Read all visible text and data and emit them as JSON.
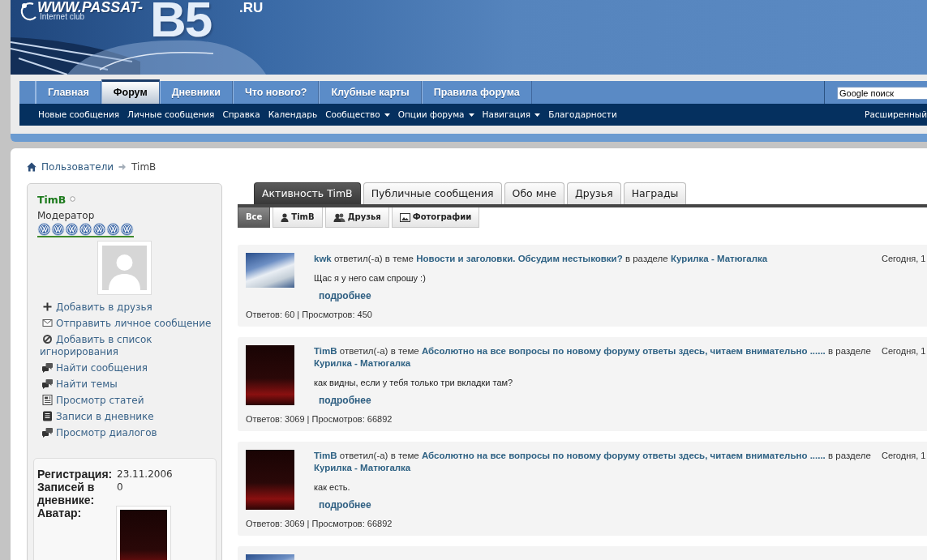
{
  "logo": {
    "site": "WWW.PASSAT-",
    "mark": "B5",
    "domain": ".RU",
    "tagline": "Internet club"
  },
  "nav": {
    "tabs": [
      {
        "label": "Главная",
        "selected": false
      },
      {
        "label": "Форум",
        "selected": true
      },
      {
        "label": "Дневники",
        "selected": false
      },
      {
        "label": "Что нового?",
        "selected": false
      },
      {
        "label": "Клубные карты",
        "selected": false
      },
      {
        "label": "Правила форума",
        "selected": false
      }
    ],
    "search": {
      "value": "Google поиск"
    }
  },
  "subnav": {
    "links": [
      {
        "label": "Новые сообщения",
        "menu": false
      },
      {
        "label": "Личные сообщения",
        "menu": false
      },
      {
        "label": "Справка",
        "menu": false
      },
      {
        "label": "Календарь",
        "menu": false
      },
      {
        "label": "Сообщество",
        "menu": true
      },
      {
        "label": "Опции форума",
        "menu": true
      },
      {
        "label": "Навигация",
        "menu": true
      },
      {
        "label": "Благодарности",
        "menu": false
      }
    ],
    "right_link": "Расширенный"
  },
  "breadcrumb": {
    "links": [
      "Пользователи"
    ],
    "current": "TimB"
  },
  "profile": {
    "name": "TimB",
    "online": false,
    "title": "Модератор",
    "rank": [
      {
        "kind": "emblem"
      },
      {
        "kind": "emblem"
      },
      {
        "kind": "emblem"
      },
      {
        "kind": "emblem"
      },
      {
        "kind": "emblem"
      },
      {
        "kind": "emblem"
      },
      {
        "kind": "emblem"
      }
    ],
    "actions": [
      {
        "kind": "plus",
        "label": "Добавить в друзья"
      },
      {
        "kind": "mail",
        "label": "Отправить личное сообщение"
      },
      {
        "kind": "ignore",
        "label": "Добавить в список игнорирования"
      },
      {
        "kind": "chat",
        "label": "Найти сообщения"
      },
      {
        "kind": "chat",
        "label": "Найти темы"
      },
      {
        "kind": "article",
        "label": "Просмотр статей"
      },
      {
        "kind": "diary",
        "label": "Записи в дневнике"
      },
      {
        "kind": "chat",
        "label": "Просмотр диалогов"
      }
    ],
    "info": [
      {
        "kind": "text",
        "label": "Регистрация:",
        "value": "23.11.2006"
      },
      {
        "kind": "text",
        "label": "Записей в дневнике:",
        "value": "0"
      },
      {
        "kind": "avatar",
        "label": "Аватар:"
      }
    ]
  },
  "tabs": [
    {
      "label": "Активность TimB",
      "selected": true
    },
    {
      "label": "Публичные сообщения",
      "selected": false
    },
    {
      "label": "Обо мне",
      "selected": false
    },
    {
      "label": "Друзья",
      "selected": false
    },
    {
      "label": "Награды",
      "selected": false
    }
  ],
  "filters": [
    {
      "kind": "plain",
      "label": "Все",
      "selected": true
    },
    {
      "kind": "person",
      "label": "TimB",
      "selected": false
    },
    {
      "kind": "people",
      "label": "Друзья",
      "selected": false
    },
    {
      "kind": "picture",
      "label": "Фотографии",
      "selected": false
    }
  ],
  "activity": [
    {
      "kind": "light",
      "author": "kwk",
      "action": "ответил(-а) в теме",
      "topic": "Новости и заголовки. Обсудим нестыковки?",
      "section_prefix": "в разделе",
      "section": "Курилка - Матюгалка",
      "date": "Сегодня, 1",
      "snippet": "Щас я у него сам спрошу :)",
      "more": "подробнее",
      "stats": "Ответов: 60 | Просмотров: 450"
    },
    {
      "kind": "dark",
      "author": "TimB",
      "action": "ответил(-а) в теме",
      "topic": "Абсолютно на все вопросы по новому форуму ответы здесь, читаем внимательно ......",
      "section_prefix": "в разделе",
      "section": "Курилка - Матюгалка",
      "date": "Сегодня, 1",
      "snippet": "как видны, если у тебя только три вкладки там?",
      "more": "подробнее",
      "stats": "Ответов: 3069 | Просмотров: 66892"
    },
    {
      "kind": "dark",
      "author": "TimB",
      "action": "ответил(-а) в теме",
      "topic": "Абсолютно на все вопросы по новому форуму ответы здесь, читаем внимательно ......",
      "section_prefix": "в разделе",
      "section": "Курилка - Матюгалка",
      "date": "Сегодня, 1",
      "snippet": "как есть.",
      "more": "подробнее",
      "stats": "Ответов: 3069 | Просмотров: 66892"
    },
    {
      "kind": "light"
    }
  ]
}
